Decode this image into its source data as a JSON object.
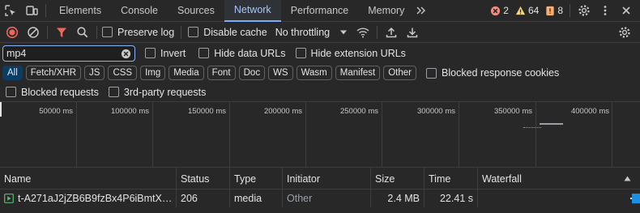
{
  "tabs": [
    "Elements",
    "Console",
    "Sources",
    "Network",
    "Performance",
    "Memory"
  ],
  "active_tab": "Network",
  "status": {
    "errors": "2",
    "warnings": "64",
    "issues": "8"
  },
  "toolbar": {
    "preserve_log": "Preserve log",
    "disable_cache": "Disable cache",
    "throttling": "No throttling"
  },
  "filter": {
    "value": "mp4",
    "invert": "Invert",
    "hide_data_urls": "Hide data URLs",
    "hide_extension_urls": "Hide extension URLs"
  },
  "types": [
    "All",
    "Fetch/XHR",
    "JS",
    "CSS",
    "Img",
    "Media",
    "Font",
    "Doc",
    "WS",
    "Wasm",
    "Manifest",
    "Other"
  ],
  "active_type": "All",
  "blocked_response_cookies": "Blocked response cookies",
  "blocked_requests": "Blocked requests",
  "third_party_requests": "3rd-party requests",
  "overview_ticks": [
    "50000 ms",
    "100000 ms",
    "150000 ms",
    "200000 ms",
    "250000 ms",
    "300000 ms",
    "350000 ms",
    "400000 ms"
  ],
  "columns": {
    "name": "Name",
    "status": "Status",
    "type": "Type",
    "initiator": "Initiator",
    "size": "Size",
    "time": "Time",
    "waterfall": "Waterfall"
  },
  "rows": [
    {
      "name": "t-A271aJ2jZB6B9fzBx4P6iBmtX…",
      "status": "206",
      "type": "media",
      "initiator": "Other",
      "size": "2.4 MB",
      "time": "22.41 s"
    }
  ],
  "colors": {
    "accent": "#8ab4f8",
    "error": "#f28b82",
    "warning": "#fdd663",
    "issue": "#fcad70",
    "record": "#ee675c"
  }
}
